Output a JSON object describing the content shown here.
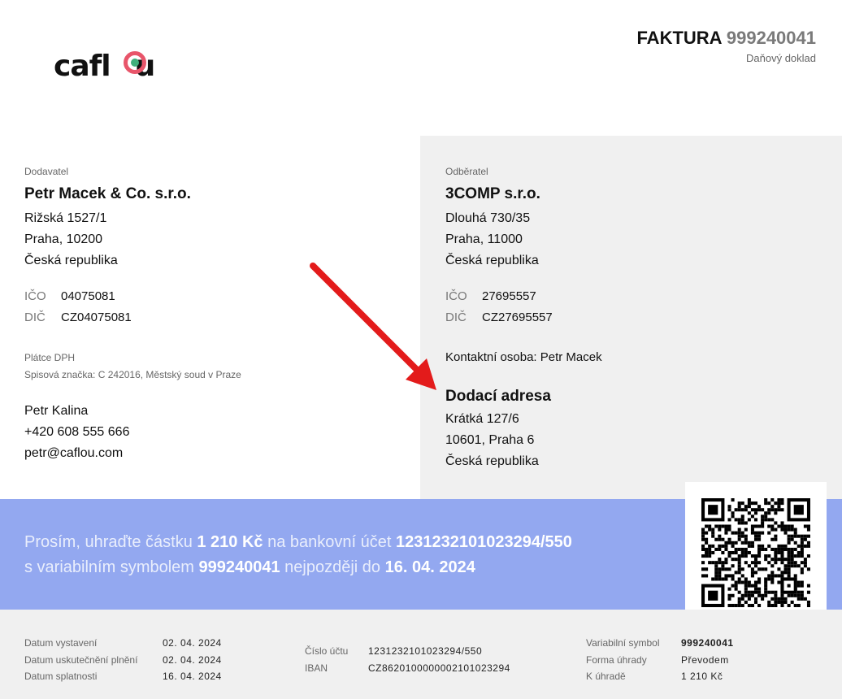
{
  "logo": {
    "text": "caflou",
    "text_left": "cafl",
    "text_right": "u"
  },
  "document": {
    "title_prefix": "FAKTURA",
    "number": "999240041",
    "subtitle": "Daňový doklad"
  },
  "supplier": {
    "label": "Dodavatel",
    "name": "Petr Macek & Co. s.r.o.",
    "street": "Rižská 1527/1",
    "city": "Praha, 10200",
    "country": "Česká republika",
    "ico_label": "IČO",
    "ico": "04075081",
    "dic_label": "DIČ",
    "dic": "CZ04075081",
    "vat_note": "Plátce DPH",
    "registry": "Spisová značka: C 242016, Městský soud v Praze",
    "contact_name": "Petr Kalina",
    "phone": "+420 608 555 666",
    "email": "petr@caflou.com"
  },
  "customer": {
    "label": "Odběratel",
    "name": "3COMP s.r.o.",
    "street": "Dlouhá 730/35",
    "city": "Praha, 11000",
    "country": "Česká republika",
    "ico_label": "IČO",
    "ico": "27695557",
    "dic_label": "DIČ",
    "dic": "CZ27695557",
    "contact_person": "Kontaktní osoba: Petr Macek",
    "delivery": {
      "title": "Dodací adresa",
      "street": "Krátká 127/6",
      "city": "10601, Praha 6",
      "country": "Česká republika"
    }
  },
  "payment": {
    "t1": "Prosím, uhraďte částku ",
    "amount": "1 210 Kč",
    "t2": " na bankovní účet ",
    "account": "123123210102329 4/550",
    "t3": "s variabilním symbolem ",
    "vs": "999240041",
    "t4": " nejpozději do ",
    "due": "16. 04. 2024"
  },
  "footer": {
    "issue_label": "Datum vystavení",
    "issue": "02. 04. 2024",
    "taxable_label": "Datum uskutečnění plnění",
    "taxable": "02. 04. 2024",
    "due_label": "Datum splatnosti",
    "due": "16. 04. 2024",
    "account_label": "Číslo účtu",
    "account": "123123210102329 4/550",
    "iban_label": "IBAN",
    "iban": "CZ8620100000002101023294",
    "vs_label": "Variabilní symbol",
    "vs": "999240041",
    "method_label": "Forma úhrady",
    "method": "Převodem",
    "total_label": "K úhradě",
    "total_amount": "1 210",
    "total_currency": "Kč"
  },
  "colors": {
    "band": "#93a8f0",
    "panel": "#f0f0f0",
    "arrow": "#e31b1b",
    "logo_ring": "#e8556a"
  }
}
